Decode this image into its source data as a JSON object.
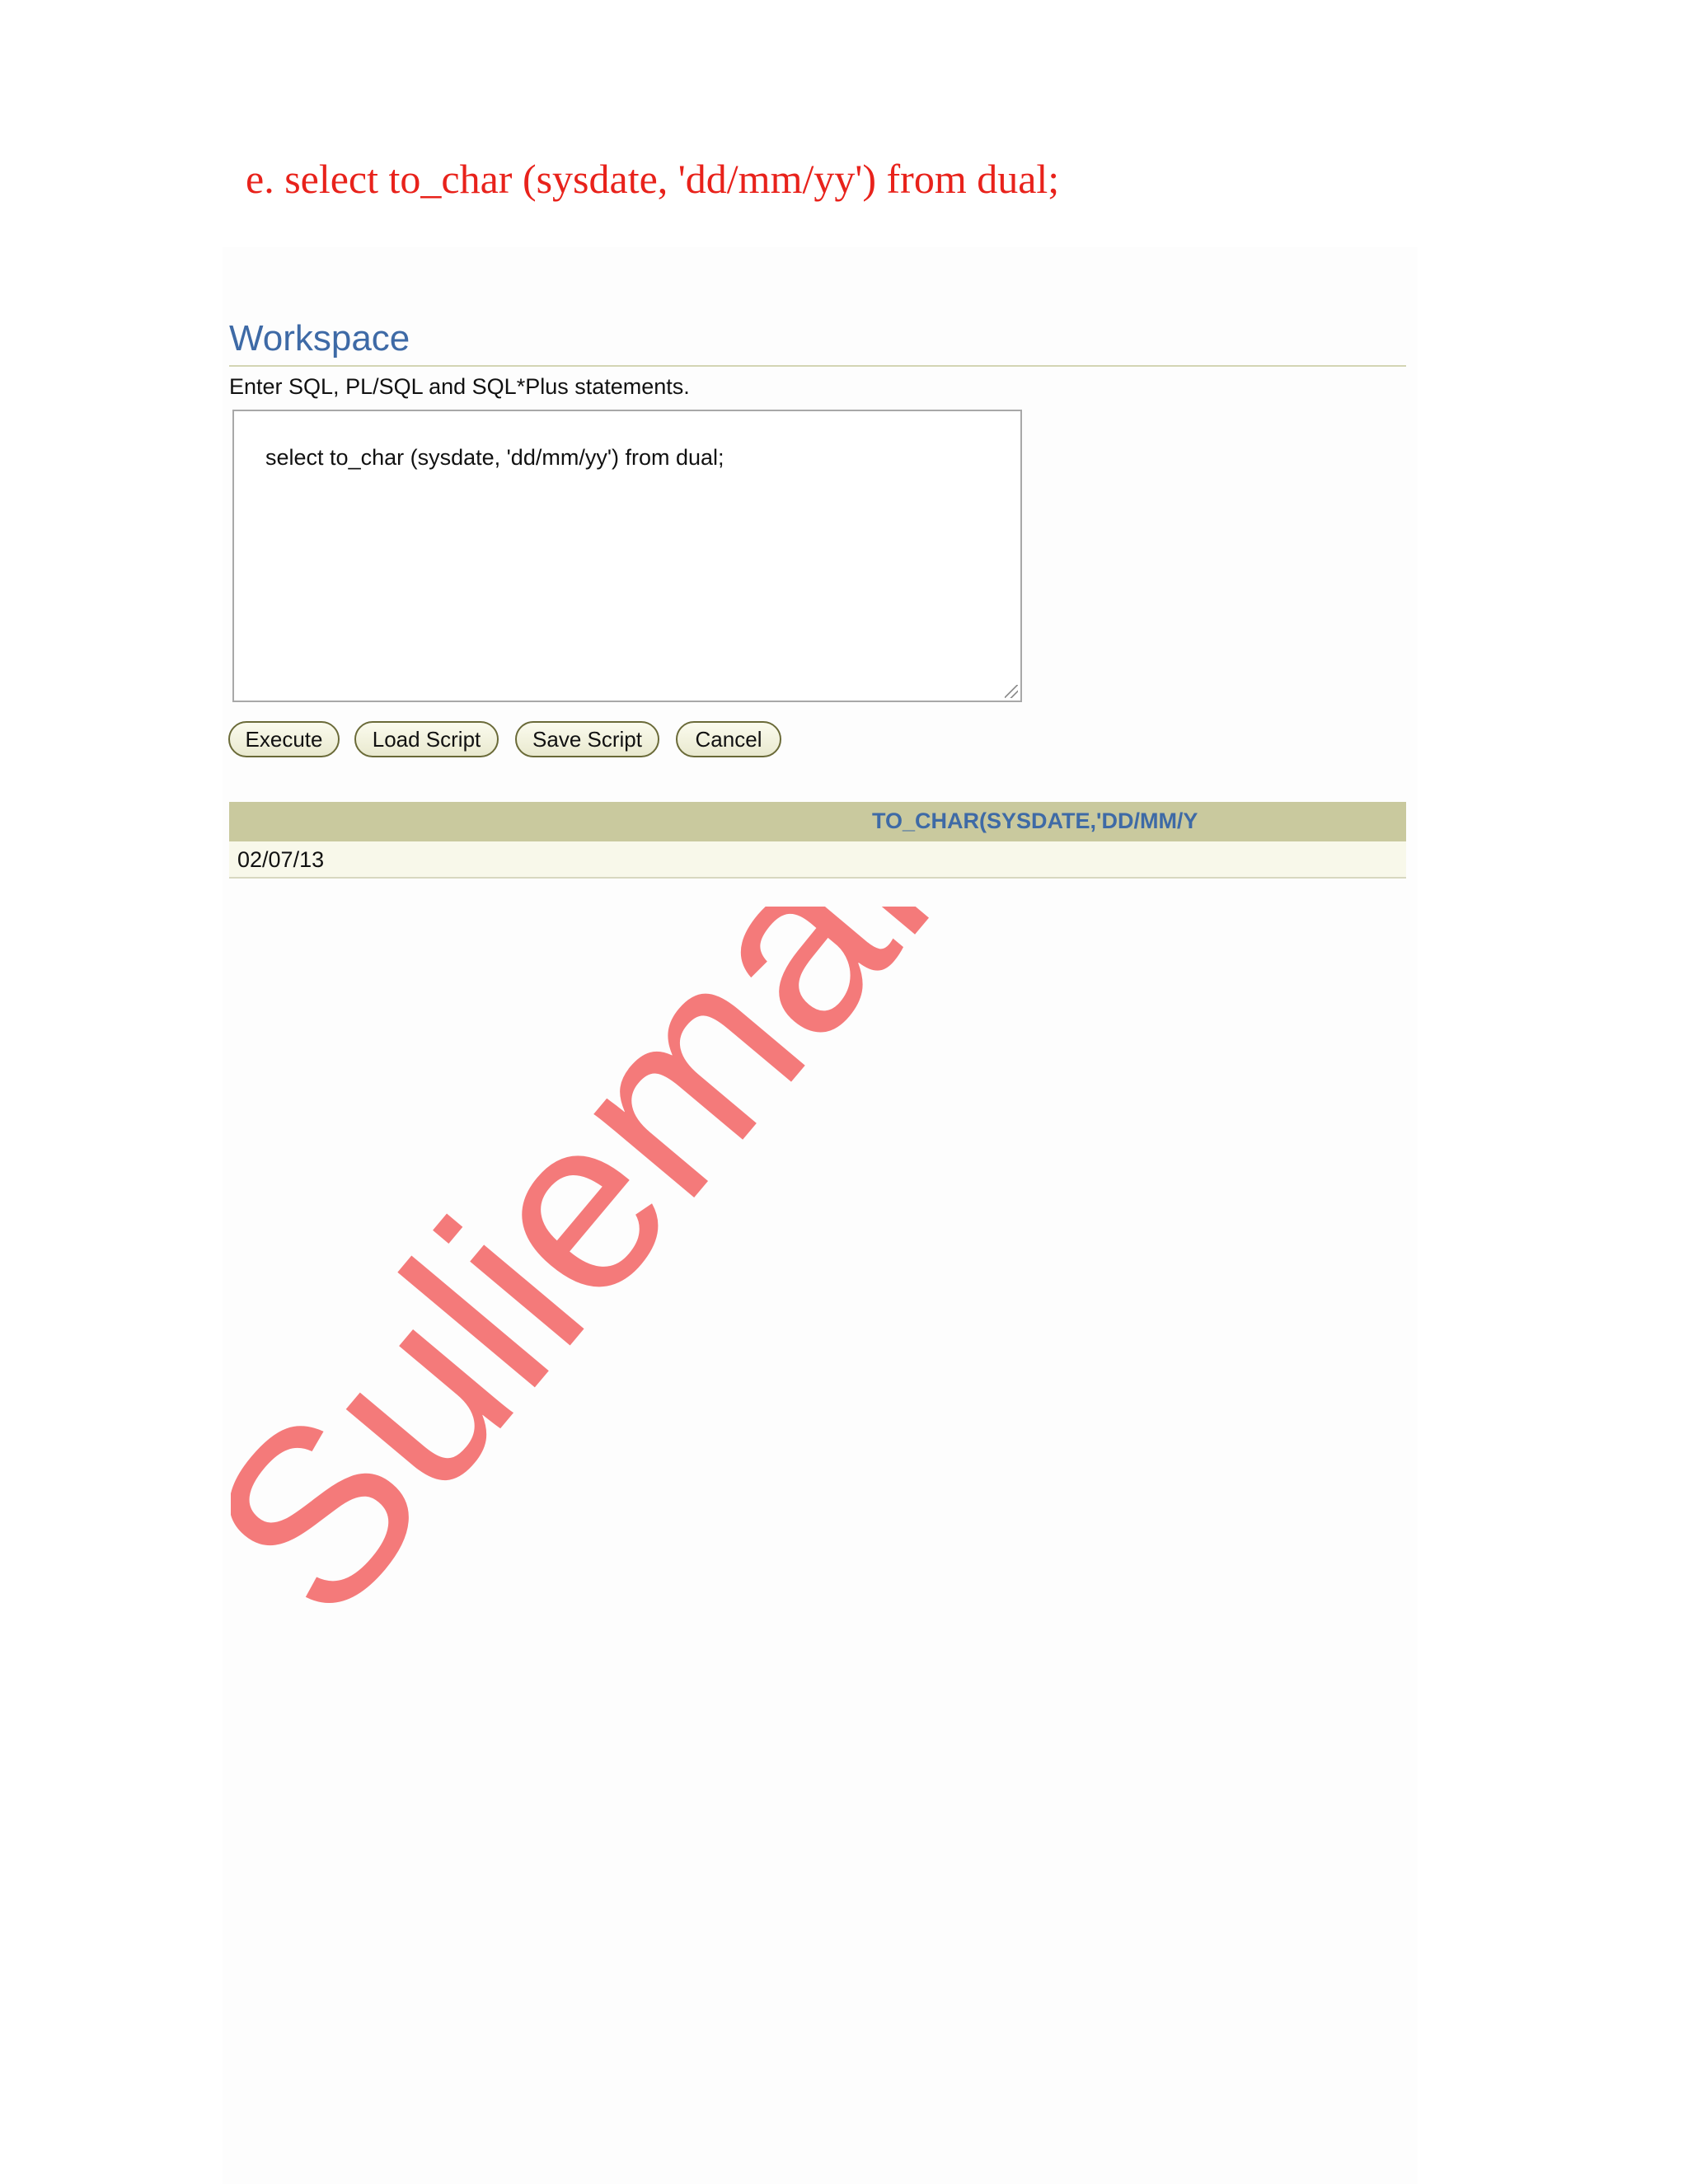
{
  "document": {
    "heading": "e. select to_char (sysdate, 'dd/mm/yy') from dual;"
  },
  "workspace": {
    "title": "Workspace",
    "instructions": "Enter SQL, PL/SQL and SQL*Plus statements.",
    "sql_text": "select to_char (sysdate, 'dd/mm/yy') from dual;"
  },
  "buttons": {
    "execute": "Execute",
    "load_script": "Load Script",
    "save_script": "Save Script",
    "cancel": "Cancel"
  },
  "results": {
    "column_header": "TO_CHAR(SYSDATE,'DD/MM/Y",
    "rows": [
      "02/07/13"
    ]
  },
  "watermark": {
    "text": "Sulieman Khe",
    "color": "#f47a7a"
  },
  "colors": {
    "heading": "#e8221b",
    "region_title": "#3e6aa6",
    "header_bg": "#c9c99e",
    "row_bg": "#f8f8ea"
  }
}
